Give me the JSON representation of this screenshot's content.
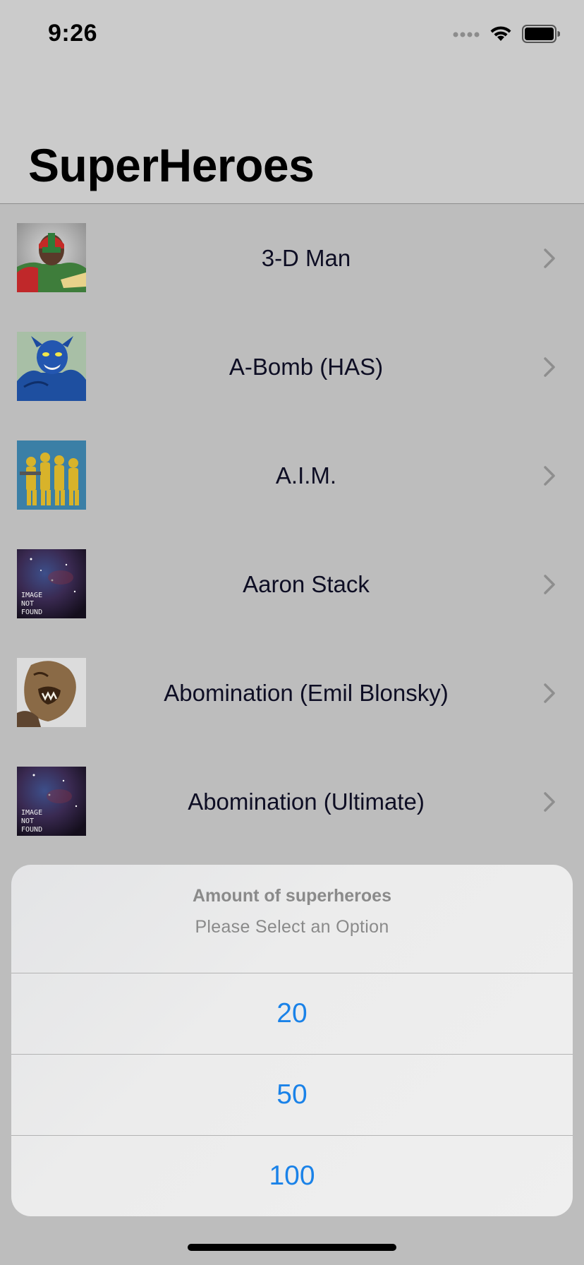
{
  "status_bar": {
    "time": "9:26",
    "icons": [
      "cellular-signal-icon",
      "wifi-icon",
      "battery-icon"
    ]
  },
  "nav": {
    "title": "SuperHeroes"
  },
  "list": {
    "items": [
      {
        "name": "3-D Man",
        "thumbnail": "3-d-man-portrait",
        "thumb_label": ""
      },
      {
        "name": "A-Bomb (HAS)",
        "thumbnail": "a-bomb-portrait",
        "thumb_label": ""
      },
      {
        "name": "A.I.M.",
        "thumbnail": "aim-group-portrait",
        "thumb_label": ""
      },
      {
        "name": "Aaron Stack",
        "thumbnail": "image-not-found",
        "thumb_label": "IMAGE NOT FOUND"
      },
      {
        "name": "Abomination (Emil Blonsky)",
        "thumbnail": "abomination-portrait",
        "thumb_label": ""
      },
      {
        "name": "Abomination (Ultimate)",
        "thumbnail": "image-not-found",
        "thumb_label": "IMAGE NOT FOUND"
      }
    ]
  },
  "action_sheet": {
    "title": "Amount of superheroes",
    "message": "Please Select an Option",
    "options": [
      {
        "label": "20"
      },
      {
        "label": "50"
      },
      {
        "label": "100"
      }
    ]
  },
  "colors": {
    "accent": "#1a82e8",
    "row_text": "#0e0e24",
    "dim_background": "#bdbdbd"
  }
}
